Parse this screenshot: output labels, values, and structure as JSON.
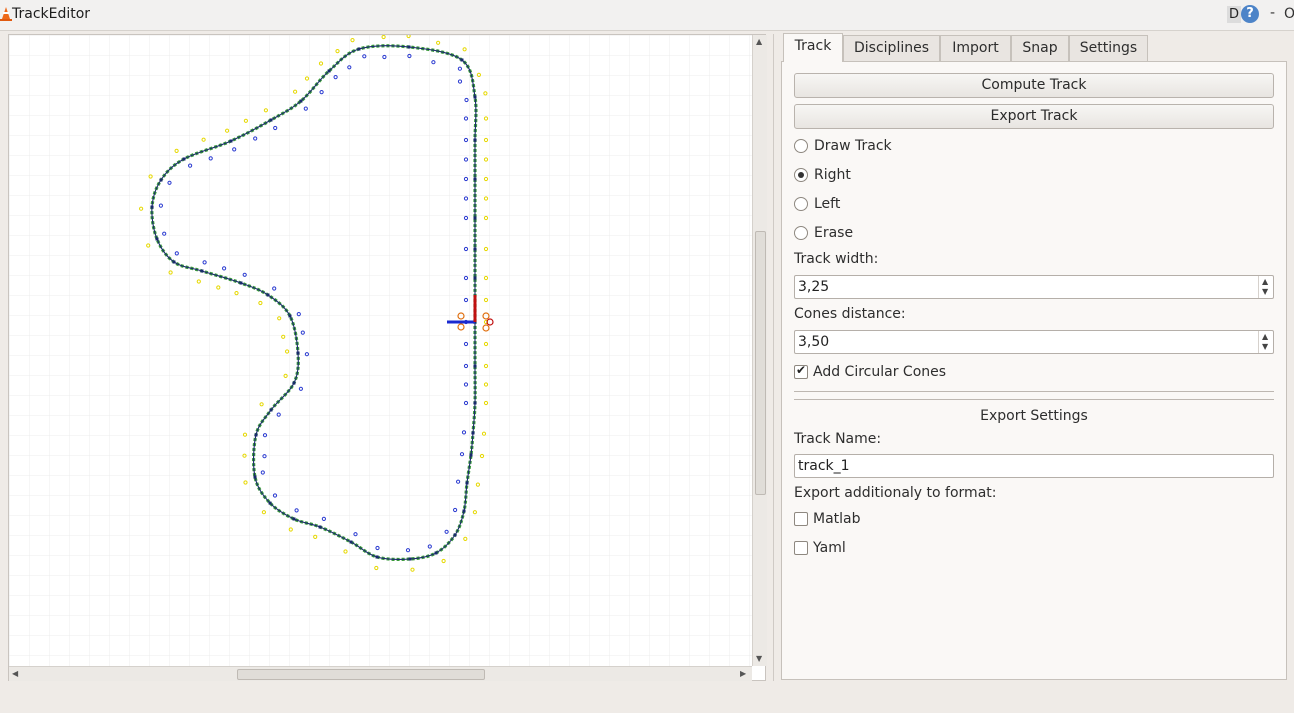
{
  "window": {
    "title": "TrackEditor",
    "help_d": "D",
    "help_q": "?",
    "minimize": "-",
    "close": "O"
  },
  "tabs": [
    "Track",
    "Disciplines",
    "Import",
    "Snap",
    "Settings"
  ],
  "active_tab": "Track",
  "track_tab": {
    "compute_button": "Compute Track",
    "export_button": "Export Track",
    "mode_options": [
      {
        "label": "Draw Track",
        "selected": false
      },
      {
        "label": "Right",
        "selected": true
      },
      {
        "label": "Left",
        "selected": false
      },
      {
        "label": "Erase",
        "selected": false
      }
    ],
    "track_width_label": "Track width:",
    "track_width_value": "3,25",
    "cones_distance_label": "Cones distance:",
    "cones_distance_value": "3,50",
    "add_circular_cones_label": "Add Circular Cones",
    "add_circular_cones_checked": true,
    "export_settings_heading": "Export Settings",
    "track_name_label": "Track Name:",
    "track_name_value": "track_1",
    "export_format_label": "Export additionaly to format:",
    "formats": [
      {
        "label": "Matlab",
        "checked": false
      },
      {
        "label": "Yaml",
        "checked": false
      }
    ]
  },
  "colors": {
    "centerline": "#1a2a6c",
    "track_edge": "#3a9a3a",
    "inner_cones": "#2a3ad0",
    "outer_cones": "#e6d800",
    "orange_cones": "#e07010",
    "start_axis_x": "#1a2ad0",
    "start_axis_y": "#c01010",
    "grid": "#ececec"
  }
}
